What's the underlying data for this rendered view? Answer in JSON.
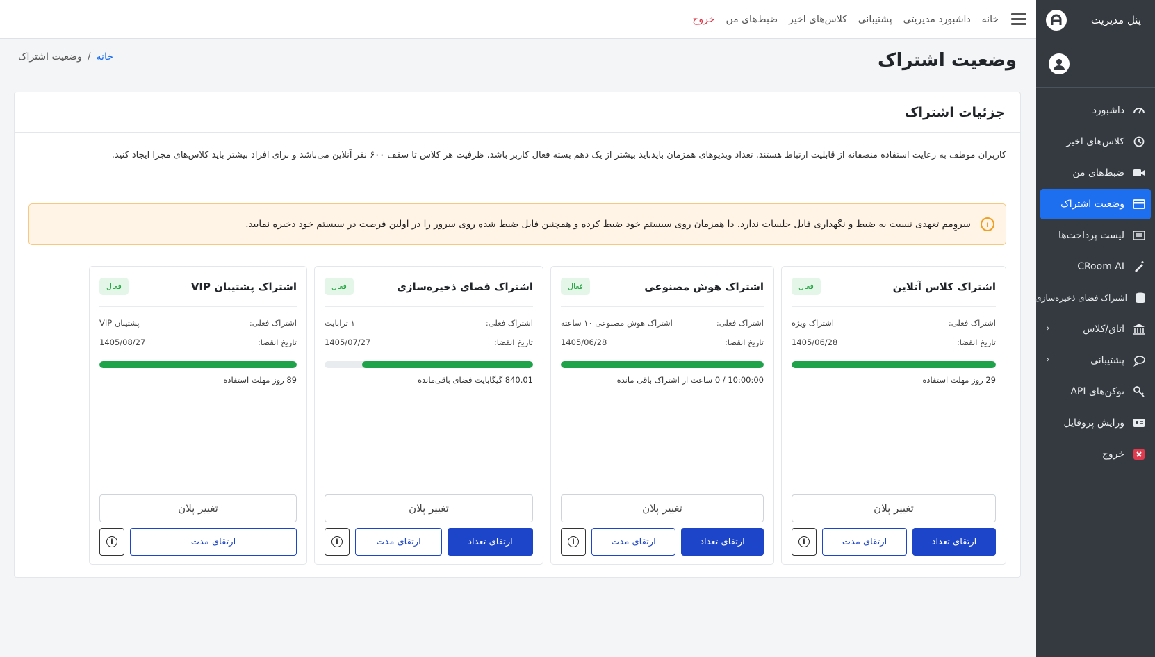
{
  "sidebar": {
    "brand_title": "پنل مدیریت",
    "items": [
      {
        "label": "داشبورد",
        "icon": "dashboard-gauge-icon"
      },
      {
        "label": "کلاس‌های اخیر",
        "icon": "history-icon"
      },
      {
        "label": "ضبط‌های من",
        "icon": "video-camera-icon"
      },
      {
        "label": "وضعیت اشتراک",
        "icon": "credit-card-icon",
        "active": true
      },
      {
        "label": "لیست پرداخت‌ها",
        "icon": "receipt-list-icon"
      },
      {
        "label": "CRoom AI",
        "icon": "magic-pen-icon"
      },
      {
        "label": "اشتراک فضای ذخیره‌سازی",
        "icon": "database-icon"
      },
      {
        "label": "اتاق/کلاس",
        "icon": "building-icon",
        "chevron": true
      },
      {
        "label": "پشتیبانی",
        "icon": "chat-bubbles-icon",
        "chevron": true
      },
      {
        "label": "توکن‌های API",
        "icon": "key-icon"
      },
      {
        "label": "ورایش پروفایل",
        "icon": "id-card-icon"
      },
      {
        "label": "خروج",
        "icon": "close-box-icon"
      }
    ]
  },
  "topbar": {
    "links": [
      "خانه",
      "داشبورد مدیریتی",
      "پشتیبانی",
      "کلاس‌های اخیر",
      "ضبط‌های من"
    ],
    "logout": "خروج"
  },
  "page": {
    "title": "وضعیت اشتراک",
    "breadcrumb_home": "خانه",
    "breadcrumb_sep": "/",
    "breadcrumb_current": "وضعیت اشتراک"
  },
  "card": {
    "header": "جزئیات اشتراک",
    "description": "کاربران موظف به رعایت استفاده منصفانه از قابلیت ارتباط هستند. تعداد ویدیوهای همزمان بایدباید بیشتر از یک دهم بسته فعال کاربر باشد. ظرفیت هر کلاس تا سقف ۶۰۰ نفر آنلاین می‌باشد و برای افراد بیشتر باید کلاس‌های مجزا ایجاد کنید.",
    "alert": "سروِمم تعهدی نسبت به ضبط و نگهداری فایل جلسات ندارد. ذا همزمان روی سیستم خود ضبط کرده و همچنین فایل ضبط شده روی سرور را در اولین فرصت در سیستم خود ذخیره نمایید."
  },
  "subscriptions": [
    {
      "title": "اشتراک کلاس آنلاین",
      "badge": "فعال",
      "current_label": "اشتراک فعلی:",
      "current_value": "اشتراک ویژه",
      "expiry_label": "تاریخ انقضا:",
      "expiry_value": "1405/06/28",
      "progress": 1.0,
      "note": "29 روز مهلت استفاده",
      "change_plan": "تغییر پلان",
      "upgrade_count": "ارتقای تعداد",
      "upgrade_duration": "ارتقای مدت"
    },
    {
      "title": "اشتراک هوش مصنوعی",
      "badge": "فعال",
      "current_label": "اشتراک فعلی:",
      "current_value": "اشتراک هوش مصنوعی ۱۰ ساعته",
      "expiry_label": "تاریخ انقضا:",
      "expiry_value": "1405/06/28",
      "progress": 1.0,
      "note": "10:00:00 / 0 ساعت از اشتراک باقی مانده",
      "change_plan": "تغییر پلان",
      "upgrade_count": "ارتقای تعداد",
      "upgrade_duration": "ارتقای مدت"
    },
    {
      "title": "اشتراک فضای ذخیره‌سازی",
      "badge": "فعال",
      "current_label": "اشتراک فعلی:",
      "current_value": "۱ ترابایت",
      "expiry_label": "تاریخ انقضا:",
      "expiry_value": "1405/07/27",
      "progress": 0.82,
      "note": "840.01 گیگابایت فضای باقی‌مانده",
      "change_plan": "تغییر پلان",
      "upgrade_count": "ارتقای تعداد",
      "upgrade_duration": "ارتقای مدت"
    },
    {
      "title": "اشتراک پشتیبان VIP",
      "badge": "فعال",
      "current_label": "اشتراک فعلی:",
      "current_value": "پشتیبان VIP",
      "expiry_label": "تاریخ انقضا:",
      "expiry_value": "1405/08/27",
      "progress": 1.0,
      "note": "89 روز مهلت استفاده",
      "change_plan": "تغییر پلان",
      "upgrade_duration": "ارتقای مدت"
    }
  ],
  "colors": {
    "sidebar_bg": "#343a40",
    "active_item": "#1e6ff0",
    "primary_button": "#1d45c9",
    "progress_fill": "#1fa34a",
    "logout_red": "#dc3545",
    "alert_bg": "#fff4e6"
  }
}
